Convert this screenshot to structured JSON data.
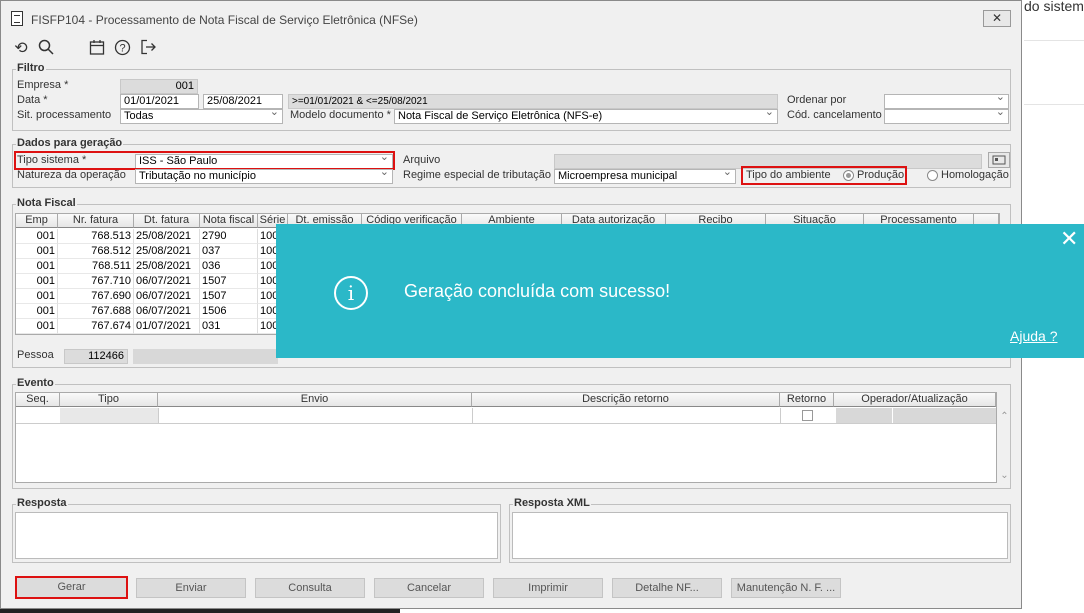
{
  "background_text": "do sistem",
  "window": {
    "title": "FISFP104 - Processamento de Nota Fiscal de Serviço Eletrônica (NFSe)",
    "close": "✕"
  },
  "toolbar": {
    "undo_icon": "undo-icon",
    "search_icon": "search-icon",
    "calendar_icon": "calendar-icon",
    "help_icon": "help-icon",
    "exit_icon": "exit-icon"
  },
  "filtro": {
    "title": "Filtro",
    "empresa_label": "Empresa *",
    "empresa_value": "001",
    "data_label": "Data *",
    "data_from": "01/01/2021",
    "data_to": "25/08/2021",
    "data_expr": ">=01/01/2021 & <=25/08/2021",
    "sit_label": "Sit. processamento",
    "sit_value": "Todas",
    "modelo_label": "Modelo documento *",
    "modelo_value": "Nota Fiscal de Serviço Eletrônica (NFS-e)",
    "ordenar_label": "Ordenar por",
    "ordenar_value": "",
    "cod_cancel_label": "Cód. cancelamento",
    "cod_cancel_value": ""
  },
  "geracao": {
    "title": "Dados para geração",
    "tipo_label": "Tipo sistema *",
    "tipo_value": "ISS - São Paulo",
    "natureza_label": "Natureza da operação",
    "natureza_value": "Tributação no município",
    "arquivo_label": "Arquivo",
    "regime_label": "Regime especial de tributação",
    "regime_value": "Microempresa municipal",
    "ambiente_label": "Tipo do ambiente",
    "producao_label": "Produção",
    "homologacao_label": "Homologação"
  },
  "nota_fiscal": {
    "title": "Nota Fiscal",
    "columns": [
      "Emp",
      "Nr. fatura",
      "Dt. fatura",
      "Nota fiscal",
      "Série",
      "Dt. emissão",
      "Código verificação",
      "Ambiente",
      "Data autorização",
      "Recibo",
      "Situação",
      "Processamento"
    ],
    "rows": [
      [
        "001",
        "768.513",
        "25/08/2021",
        "2790",
        "100"
      ],
      [
        "001",
        "768.512",
        "25/08/2021",
        "037",
        "100"
      ],
      [
        "001",
        "768.511",
        "25/08/2021",
        "036",
        "100"
      ],
      [
        "001",
        "767.710",
        "06/07/2021",
        "1507",
        "100"
      ],
      [
        "001",
        "767.690",
        "06/07/2021",
        "1507",
        "100"
      ],
      [
        "001",
        "767.688",
        "06/07/2021",
        "1506",
        "100"
      ],
      [
        "001",
        "767.674",
        "01/07/2021",
        "031",
        "100"
      ]
    ],
    "pessoa_label": "Pessoa",
    "pessoa_value": "112466"
  },
  "evento": {
    "title": "Evento",
    "columns": [
      "Seq.",
      "Tipo",
      "Envio",
      "Descrição retorno",
      "Retorno",
      "Operador/Atualização"
    ]
  },
  "resposta": {
    "title": "Resposta",
    "xml_title": "Resposta XML"
  },
  "buttons": {
    "gerar": "Gerar",
    "enviar": "Enviar",
    "consulta": "Consulta",
    "cancelar": "Cancelar",
    "imprimir": "Imprimir",
    "detalhe": "Detalhe NF...",
    "manutencao": "Manutenção N. F. ..."
  },
  "toast": {
    "message": "Geração concluída com sucesso!",
    "help": "Ajuda ?",
    "close": "✕",
    "icon": "info-icon",
    "color": "#2bb8c8"
  }
}
